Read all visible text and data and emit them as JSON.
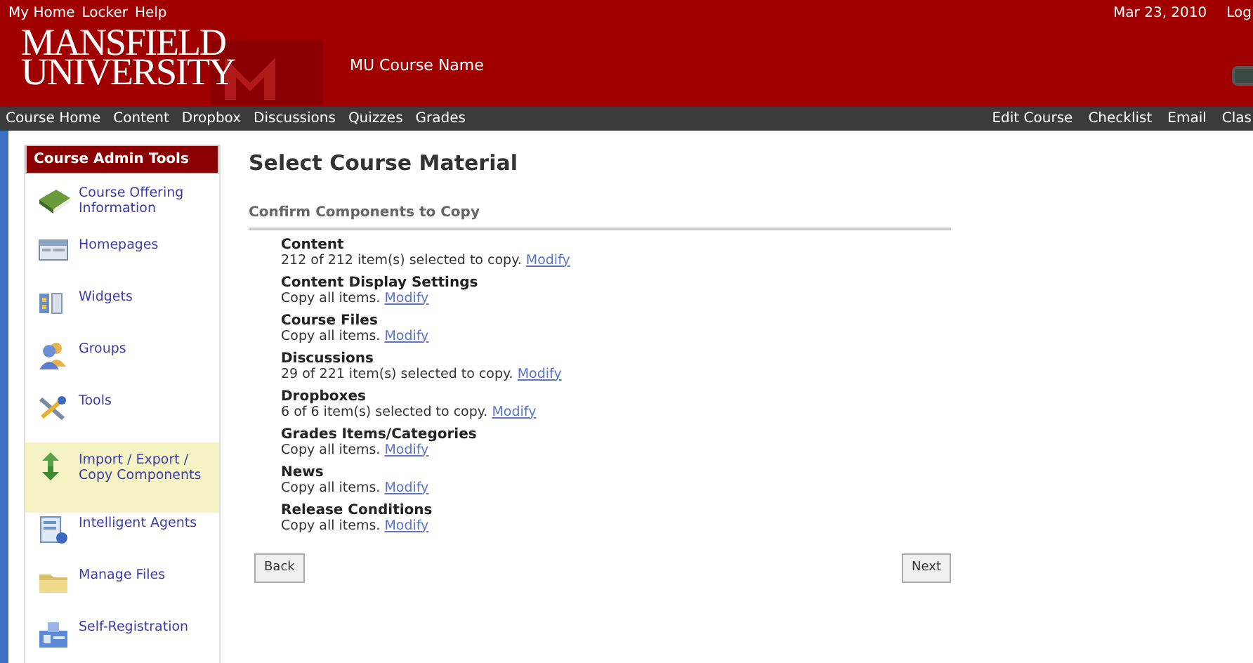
{
  "top_links": [
    "My Home",
    "Locker",
    "Help"
  ],
  "date": "Mar 23, 2010",
  "top_right_link": "Log",
  "logo": [
    "MANSFIELD",
    "UNIVERSITY"
  ],
  "course_name": "MU Course Name",
  "nav_left": [
    "Course Home",
    "Content",
    "Dropbox",
    "Discussions",
    "Quizzes",
    "Grades"
  ],
  "nav_right": [
    "Edit Course",
    "Checklist",
    "Email",
    "Clas"
  ],
  "sidebar": {
    "title": "Course Admin Tools",
    "items": [
      {
        "label": "Course Offering Information",
        "selected": false
      },
      {
        "label": "Homepages",
        "selected": false
      },
      {
        "label": "Widgets",
        "selected": false
      },
      {
        "label": "Groups",
        "selected": false
      },
      {
        "label": "Tools",
        "selected": false
      },
      {
        "label": "Import / Export / Copy Components",
        "selected": true
      },
      {
        "label": "Intelligent Agents",
        "selected": false
      },
      {
        "label": "Manage Files",
        "selected": false
      },
      {
        "label": "Self-Registration",
        "selected": false
      }
    ]
  },
  "page_title": "Select Course Material",
  "section_title": "Confirm Components to Copy",
  "components": [
    {
      "name": "Content",
      "summary": "212 of 212 item(s) selected to copy.",
      "link": "Modify"
    },
    {
      "name": "Content Display Settings",
      "summary": "Copy all items.",
      "link": "Modify"
    },
    {
      "name": "Course Files",
      "summary": "Copy all items.",
      "link": "Modify"
    },
    {
      "name": "Discussions",
      "summary": "29 of 221 item(s) selected to copy.",
      "link": "Modify"
    },
    {
      "name": "Dropboxes",
      "summary": "6 of 6 item(s) selected to copy.",
      "link": "Modify"
    },
    {
      "name": "Grades Items/Categories",
      "summary": "Copy all items.",
      "link": "Modify"
    },
    {
      "name": "News",
      "summary": "Copy all items.",
      "link": "Modify"
    },
    {
      "name": "Release Conditions",
      "summary": "Copy all items.",
      "link": "Modify"
    }
  ],
  "buttons": [
    "Back",
    "Next"
  ]
}
